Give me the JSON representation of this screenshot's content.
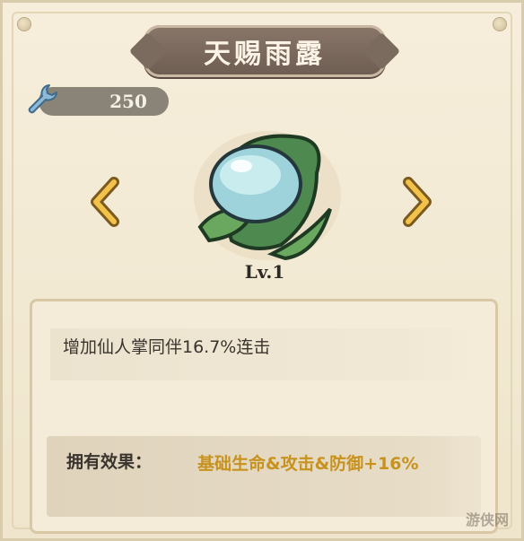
{
  "title": "天赐雨露",
  "currency": {
    "icon": "wrench-icon",
    "value": "250"
  },
  "item": {
    "level": "Lv.1"
  },
  "description": "增加仙人掌同伴16.7%连击",
  "effect": {
    "label": "拥有效果：",
    "value": "基础生命&攻击&防御+16%"
  },
  "watermark": "游侠网",
  "colors": {
    "accent_gold": "#c7921e",
    "banner": "#7b6a5e",
    "text": "#3a342e"
  }
}
